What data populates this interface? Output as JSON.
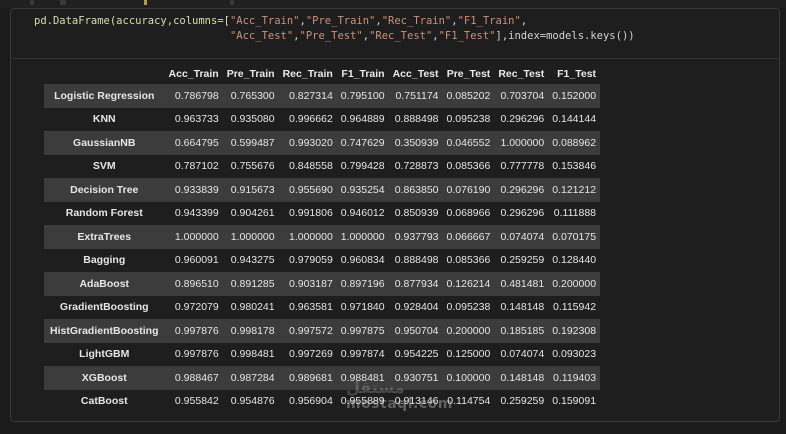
{
  "code": {
    "line1_a": "pd.DataFrame(accuracy,columns=[",
    "line1_s1": "\"Acc_Train\"",
    "line1_s2": "\"Pre_Train\"",
    "line1_s3": "\"Rec_Train\"",
    "line1_s4": "\"F1_Train\"",
    "line2_s1": "\"Acc_Test\"",
    "line2_s2": "\"Pre_Test\"",
    "line2_s3": "\"Rec_Test\"",
    "line2_s4": "\"F1_Test\"",
    "line2_tail": "],index=models.keys())"
  },
  "table": {
    "columns": [
      "",
      "Acc_Train",
      "Pre_Train",
      "Rec_Train",
      "F1_Train",
      "Acc_Test",
      "Pre_Test",
      "Rec_Test",
      "F1_Test"
    ],
    "rows": [
      {
        "name": "Logistic Regression",
        "values": [
          "0.786798",
          "0.765300",
          "0.827314",
          "0.795100",
          "0.751174",
          "0.085202",
          "0.703704",
          "0.152000"
        ]
      },
      {
        "name": "KNN",
        "values": [
          "0.963733",
          "0.935080",
          "0.996662",
          "0.964889",
          "0.888498",
          "0.095238",
          "0.296296",
          "0.144144"
        ]
      },
      {
        "name": "GaussianNB",
        "values": [
          "0.664795",
          "0.599487",
          "0.993020",
          "0.747629",
          "0.350939",
          "0.046552",
          "1.000000",
          "0.088962"
        ]
      },
      {
        "name": "SVM",
        "values": [
          "0.787102",
          "0.755676",
          "0.848558",
          "0.799428",
          "0.728873",
          "0.085366",
          "0.777778",
          "0.153846"
        ]
      },
      {
        "name": "Decision Tree",
        "values": [
          "0.933839",
          "0.915673",
          "0.955690",
          "0.935254",
          "0.863850",
          "0.076190",
          "0.296296",
          "0.121212"
        ]
      },
      {
        "name": "Random Forest",
        "values": [
          "0.943399",
          "0.904261",
          "0.991806",
          "0.946012",
          "0.850939",
          "0.068966",
          "0.296296",
          "0.111888"
        ]
      },
      {
        "name": "ExtraTrees",
        "values": [
          "1.000000",
          "1.000000",
          "1.000000",
          "1.000000",
          "0.937793",
          "0.066667",
          "0.074074",
          "0.070175"
        ]
      },
      {
        "name": "Bagging",
        "values": [
          "0.960091",
          "0.943275",
          "0.979059",
          "0.960834",
          "0.888498",
          "0.085366",
          "0.259259",
          "0.128440"
        ]
      },
      {
        "name": "AdaBoost",
        "values": [
          "0.896510",
          "0.891285",
          "0.903187",
          "0.897196",
          "0.877934",
          "0.126214",
          "0.481481",
          "0.200000"
        ]
      },
      {
        "name": "GradientBoosting",
        "values": [
          "0.972079",
          "0.980241",
          "0.963581",
          "0.971840",
          "0.928404",
          "0.095238",
          "0.148148",
          "0.115942"
        ]
      },
      {
        "name": "HistGradientBoosting",
        "values": [
          "0.997876",
          "0.998178",
          "0.997572",
          "0.997875",
          "0.950704",
          "0.200000",
          "0.185185",
          "0.192308"
        ]
      },
      {
        "name": "LightGBM",
        "values": [
          "0.997876",
          "0.998481",
          "0.997269",
          "0.997874",
          "0.954225",
          "0.125000",
          "0.074074",
          "0.093023"
        ]
      },
      {
        "name": "XGBoost",
        "values": [
          "0.988467",
          "0.987284",
          "0.989681",
          "0.988481",
          "0.930751",
          "0.100000",
          "0.148148",
          "0.119403"
        ]
      },
      {
        "name": "CatBoost",
        "values": [
          "0.955842",
          "0.954876",
          "0.956904",
          "0.955889",
          "0.913146",
          "0.114754",
          "0.259259",
          "0.159091"
        ]
      }
    ]
  },
  "watermark": "mostaql.com",
  "watermark_logo": "مستقل"
}
